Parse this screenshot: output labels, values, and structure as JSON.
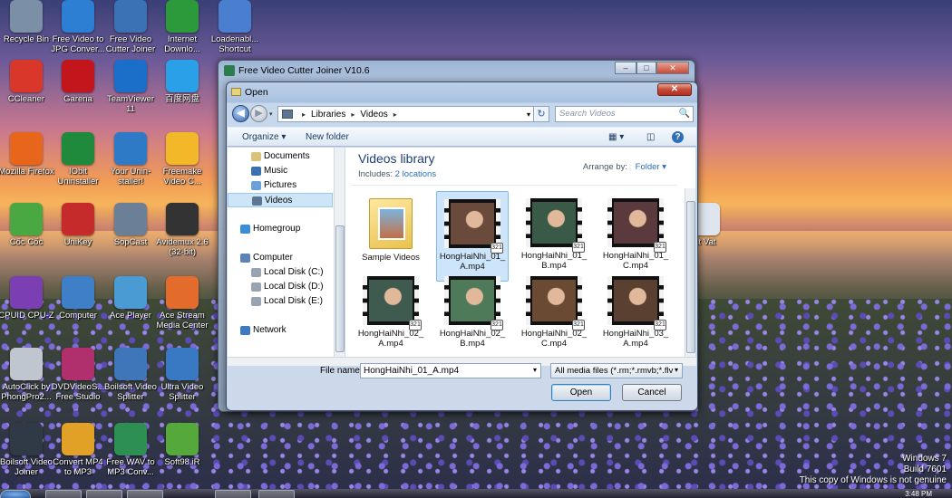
{
  "desktop": {
    "icons": [
      {
        "label": "Recycle Bin",
        "icon": "recycle-bin-icon",
        "color": "#7b8fa6"
      },
      {
        "label": "Free Video to JPG Conver...",
        "icon": "jpg-converter-icon",
        "color": "#2c7fd3"
      },
      {
        "label": "Free Video Cutter Joiner",
        "icon": "cutter-joiner-icon",
        "color": "#3b72b6"
      },
      {
        "label": "Internet Downlo...",
        "icon": "internet-download-icon",
        "color": "#2c9a3a"
      },
      {
        "label": "Loadenabl... Shortcut",
        "icon": "loader-icon",
        "color": "#4a7fd0"
      },
      {
        "label": "CCleaner",
        "icon": "ccleaner-icon",
        "color": "#d8372a"
      },
      {
        "label": "Garena",
        "icon": "garena-icon",
        "color": "#c2161c"
      },
      {
        "label": "TeamViewer 11",
        "icon": "teamviewer-icon",
        "color": "#1b6fc8"
      },
      {
        "label": "百度网盘",
        "icon": "baidu-netdisk-icon",
        "color": "#2aa0e8"
      },
      {
        "label": "Mozilla Firefox",
        "icon": "firefox-icon",
        "color": "#e8661c"
      },
      {
        "label": "IObit Uninstaller",
        "icon": "iobit-icon",
        "color": "#1f8a3c"
      },
      {
        "label": "Your Unin-staller!",
        "icon": "uninstaller-icon",
        "color": "#2f7ac7"
      },
      {
        "label": "Freemake Video C...",
        "icon": "freemake-icon",
        "color": "#f2b82a"
      },
      {
        "label": "Cốc Cốc",
        "icon": "coccoc-icon",
        "color": "#4aa843"
      },
      {
        "label": "UniKey",
        "icon": "unikey-icon",
        "color": "#c62b2b"
      },
      {
        "label": "SopCast",
        "icon": "sopcast-icon",
        "color": "#6b7f96"
      },
      {
        "label": "Avidemux 2.6 (32-bit)",
        "icon": "avidemux-icon",
        "color": "#333333"
      },
      {
        "label": "CPUID CPU-Z",
        "icon": "cpuz-icon",
        "color": "#7b3fb3"
      },
      {
        "label": "Computer",
        "icon": "computer-icon",
        "color": "#3f7fc7"
      },
      {
        "label": "Ace Player",
        "icon": "ace-player-icon",
        "color": "#4a9ad4"
      },
      {
        "label": "Ace Stream Media Center",
        "icon": "ace-stream-icon",
        "color": "#e36b2c"
      },
      {
        "label": "AutoClick by PhongPro2...",
        "icon": "autoclick-icon",
        "color": "#c0c6cf"
      },
      {
        "label": "DVDVideoS... Free Studio",
        "icon": "dvdvideosoft-icon",
        "color": "#b0306e"
      },
      {
        "label": "Boilsoft Video Splitter",
        "icon": "boilsoft-splitter-icon",
        "color": "#3f76b9"
      },
      {
        "label": "Ultra Video Splitter",
        "icon": "ultra-splitter-icon",
        "color": "#3978c3"
      },
      {
        "label": "Boilsoft Video Joiner",
        "icon": "boilsoft-joiner-icon",
        "color": "#2f3a46"
      },
      {
        "label": "Convert MP4 to MP3",
        "icon": "convert-mp4-icon",
        "color": "#e0a126"
      },
      {
        "label": "Free WAV to MP3 Conv...",
        "icon": "wav-mp3-icon",
        "color": "#2e8f52"
      },
      {
        "label": "Soft98.iR",
        "icon": "soft98-icon",
        "color": "#55a83a"
      },
      {
        "label": "...t Vat",
        "icon": "document-icon",
        "color": "#dfe5ee"
      }
    ],
    "watermark": {
      "line1": "Windows 7",
      "line2": "Build 7601",
      "line3": "This copy of Windows is not genuine"
    },
    "clock": "3:48 PM"
  },
  "app_window": {
    "title": "Free Video Cutter Joiner V10.6",
    "buttons": {
      "minimize": "–",
      "maximize": "□",
      "close": "✕"
    }
  },
  "dialog": {
    "title": "Open",
    "close_label": "✕",
    "nav": {
      "back": "◀",
      "forward": "▶",
      "dropdown": "▾"
    },
    "address": {
      "crumbs": [
        "Libraries",
        "Videos"
      ],
      "sep": "▸",
      "dropdown": "▾"
    },
    "refresh": "↻",
    "search": {
      "placeholder": "Search Videos",
      "icon": "🔍"
    },
    "toolbar": {
      "organize": "Organize ▾",
      "new_folder": "New folder",
      "view": "▦ ▾",
      "pane": "◫",
      "help": "?"
    },
    "sidebar": {
      "items": [
        {
          "label": "Documents",
          "icon": "documents-icon",
          "color": "#d9c27a"
        },
        {
          "label": "Music",
          "icon": "music-icon",
          "color": "#3a6fb0"
        },
        {
          "label": "Pictures",
          "icon": "pictures-icon",
          "color": "#6da0d8"
        },
        {
          "label": "Videos",
          "icon": "videos-icon",
          "color": "#5d7493",
          "selected": true
        },
        {
          "label": "Homegroup",
          "icon": "homegroup-icon",
          "color": "#3b8ed6"
        },
        {
          "label": "Computer",
          "icon": "computer-icon",
          "color": "#5b83b5"
        },
        {
          "label": "Local Disk (C:)",
          "icon": "disk-icon",
          "color": "#9aa4b0"
        },
        {
          "label": "Local Disk (D:)",
          "icon": "disk-icon",
          "color": "#9aa4b0"
        },
        {
          "label": "Local Disk (E:)",
          "icon": "disk-icon",
          "color": "#9aa4b0"
        },
        {
          "label": "Network",
          "icon": "network-icon",
          "color": "#3f79c0"
        }
      ]
    },
    "library": {
      "title": "Videos library",
      "includes_label": "Includes:",
      "includes_link": "2 locations",
      "arrange_label": "Arrange by:",
      "arrange_value": "Folder ▾"
    },
    "files": [
      {
        "name": "Sample Videos",
        "type": "folder"
      },
      {
        "name": "HongHaiNhi_01_A.mp4",
        "type": "video",
        "selected": true,
        "color": "#6a4a3a"
      },
      {
        "name": "HongHaiNhi_01_B.mp4",
        "type": "video",
        "color": "#3a5a48"
      },
      {
        "name": "HongHaiNhi_01_C.mp4",
        "type": "video",
        "color": "#5a3a3c"
      },
      {
        "name": "HongHaiNhi_02_A.mp4",
        "type": "video",
        "color": "#3f5a4f"
      },
      {
        "name": "HongHaiNhi_02_B.mp4",
        "type": "video",
        "color": "#4f7a5a"
      },
      {
        "name": "HongHaiNhi_02_C.mp4",
        "type": "video",
        "color": "#6a4a32"
      },
      {
        "name": "HongHaiNhi_03_A.mp4",
        "type": "video",
        "color": "#5a4030"
      }
    ],
    "badge": "321",
    "filename_label": "File name:",
    "filename_value": "HongHaiNhi_01_A.mp4",
    "filename_dropdown": "▾",
    "filter_value": "All media files (*.rm;*.rmvb;*.flv",
    "filter_dropdown": "▾",
    "open_button": "Open",
    "cancel_button": "Cancel"
  }
}
